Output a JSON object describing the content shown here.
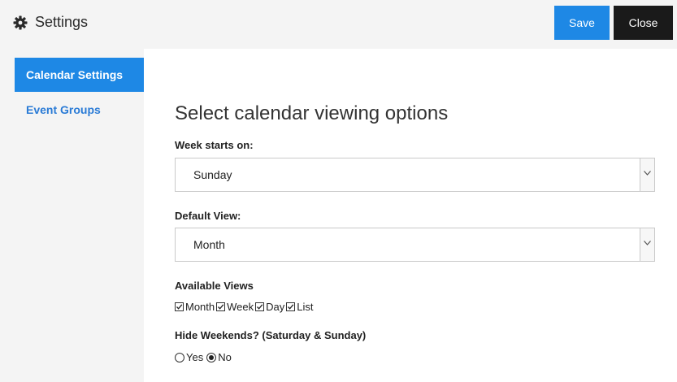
{
  "header": {
    "title": "Settings",
    "icon": "gear-icon",
    "save_label": "Save",
    "close_label": "Close",
    "accent_color": "#1e88e5"
  },
  "sidebar": {
    "items": [
      {
        "label": "Calendar Settings",
        "active": true
      },
      {
        "label": "Event Groups",
        "active": false
      }
    ]
  },
  "main": {
    "heading": "Select calendar viewing options",
    "week_starts": {
      "label": "Week starts on:",
      "value": "Sunday"
    },
    "default_view": {
      "label": "Default View:",
      "value": "Month"
    },
    "available_views": {
      "label": "Available Views",
      "options": [
        {
          "label": "Month",
          "checked": true
        },
        {
          "label": "Week",
          "checked": true
        },
        {
          "label": "Day",
          "checked": true
        },
        {
          "label": "List",
          "checked": true
        }
      ]
    },
    "hide_weekends": {
      "label": "Hide Weekends? (Saturday & Sunday)",
      "options": [
        {
          "label": "Yes",
          "selected": false
        },
        {
          "label": "No",
          "selected": true
        }
      ]
    }
  }
}
